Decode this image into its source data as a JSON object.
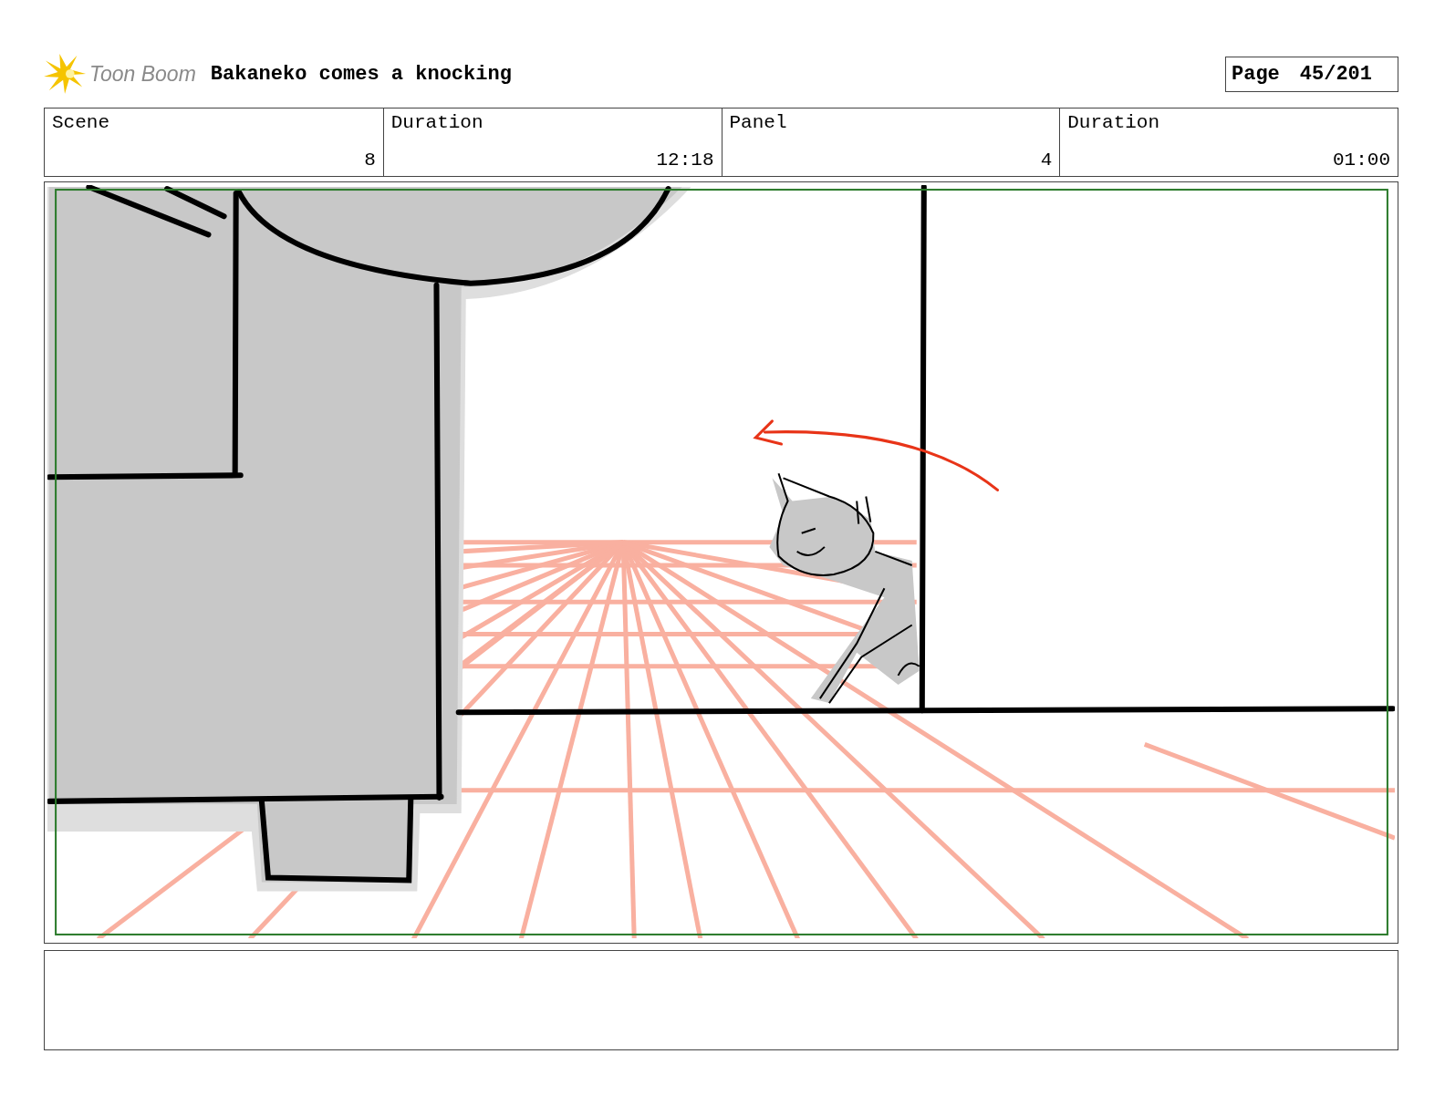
{
  "header": {
    "brand": "Toon Boom",
    "title": "Bakaneko comes a knocking",
    "page_label": "Page",
    "page_number": "45/201"
  },
  "info_table": {
    "columns": [
      "Scene",
      "Duration",
      "Panel",
      "Duration"
    ],
    "values": [
      "8",
      "12:18",
      "4",
      "01:00"
    ]
  }
}
